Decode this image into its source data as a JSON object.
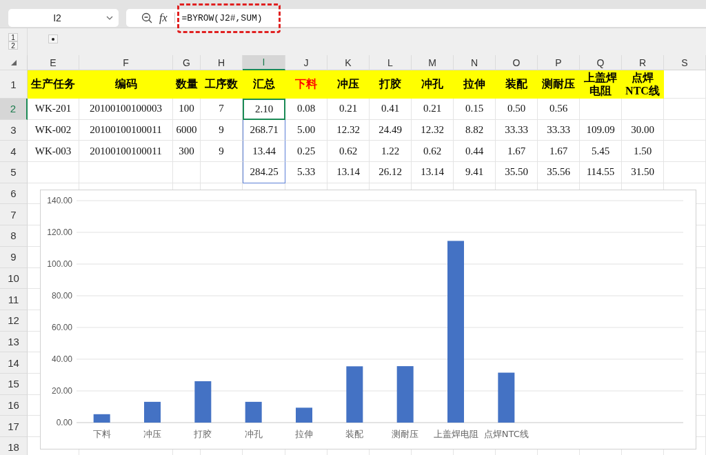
{
  "formula_bar": {
    "name_box": "I2",
    "function_label": "fx",
    "formula": "=BYROW(J2#,SUM)",
    "highlighted": true
  },
  "outline": {
    "levels": [
      "1",
      "2"
    ]
  },
  "columns": [
    {
      "label": "E",
      "selected": false
    },
    {
      "label": "F",
      "selected": false
    },
    {
      "label": "G",
      "selected": false
    },
    {
      "label": "H",
      "selected": false
    },
    {
      "label": "I",
      "selected": true
    },
    {
      "label": "J",
      "selected": false
    },
    {
      "label": "K",
      "selected": false
    },
    {
      "label": "L",
      "selected": false
    },
    {
      "label": "M",
      "selected": false
    },
    {
      "label": "N",
      "selected": false
    },
    {
      "label": "O",
      "selected": false
    },
    {
      "label": "P",
      "selected": false
    },
    {
      "label": "Q",
      "selected": false
    },
    {
      "label": "R",
      "selected": false
    },
    {
      "label": "S",
      "selected": false
    }
  ],
  "rows": [
    {
      "header": "1",
      "kind": "header",
      "selected": false,
      "cells": [
        {
          "text": "生产任务",
          "color": "#000000"
        },
        {
          "text": "编码",
          "color": "#000000"
        },
        {
          "text": "数量",
          "color": "#000000"
        },
        {
          "text": "工序数",
          "color": "#000000"
        },
        {
          "text": "汇总",
          "color": "#000000"
        },
        {
          "text": "下料",
          "color": "#ff0000"
        },
        {
          "text": "冲压",
          "color": "#000000"
        },
        {
          "text": "打胶",
          "color": "#000000"
        },
        {
          "text": "冲孔",
          "color": "#000000"
        },
        {
          "text": "拉伸",
          "color": "#000000"
        },
        {
          "text": "装配",
          "color": "#000000"
        },
        {
          "text": "测耐压",
          "color": "#000000"
        },
        {
          "text": "上盖焊电阻",
          "color": "#000000"
        },
        {
          "text": "点焊NTC线",
          "color": "#000000"
        }
      ]
    },
    {
      "header": "2",
      "kind": "data",
      "selected": true,
      "range": false,
      "cells": [
        "WK-201",
        "20100100100003",
        "100",
        "7",
        "2.10",
        "0.08",
        "0.21",
        "0.41",
        "0.21",
        "0.15",
        "0.50",
        "0.56",
        null,
        null
      ]
    },
    {
      "header": "3",
      "kind": "data",
      "selected": false,
      "range": true,
      "cells": [
        "WK-002",
        "20100100100011",
        "6000",
        "9",
        "268.71",
        "5.00",
        "12.32",
        "24.49",
        "12.32",
        "8.82",
        "33.33",
        "33.33",
        "109.09",
        "30.00"
      ]
    },
    {
      "header": "4",
      "kind": "data",
      "selected": false,
      "range": true,
      "cells": [
        "WK-003",
        "20100100100011",
        "300",
        "9",
        "13.44",
        "0.25",
        "0.62",
        "1.22",
        "0.62",
        "0.44",
        "1.67",
        "1.67",
        "5.45",
        "1.50"
      ]
    },
    {
      "header": "5",
      "kind": "data",
      "selected": false,
      "range": true,
      "cells": [
        null,
        null,
        null,
        null,
        "284.25",
        "5.33",
        "13.14",
        "26.12",
        "13.14",
        "9.41",
        "35.50",
        "35.56",
        "114.55",
        "31.50"
      ]
    },
    {
      "header": "6",
      "kind": "empty",
      "selected": false,
      "range": false
    },
    {
      "header": "7",
      "kind": "empty",
      "selected": false,
      "range": false
    },
    {
      "header": "8",
      "kind": "empty",
      "selected": false,
      "range": false
    },
    {
      "header": "9",
      "kind": "empty",
      "selected": false,
      "range": false
    },
    {
      "header": "10",
      "kind": "empty",
      "selected": false,
      "range": false
    },
    {
      "header": "11",
      "kind": "empty",
      "selected": false,
      "range": false
    },
    {
      "header": "12",
      "kind": "empty",
      "selected": false,
      "range": false
    },
    {
      "header": "13",
      "kind": "empty",
      "selected": false,
      "range": false
    },
    {
      "header": "14",
      "kind": "empty",
      "selected": false,
      "range": false
    },
    {
      "header": "15",
      "kind": "empty",
      "selected": false,
      "range": false
    },
    {
      "header": "16",
      "kind": "empty",
      "selected": false,
      "range": false
    },
    {
      "header": "17",
      "kind": "empty",
      "selected": false,
      "range": false
    },
    {
      "header": "18",
      "kind": "empty",
      "selected": false,
      "range": false
    }
  ],
  "chart": {
    "chart_data": {
      "type": "bar",
      "categories": [
        "下料",
        "冲压",
        "打胶",
        "冲孔",
        "拉伸",
        "装配",
        "测耐压",
        "上盖焊电阻",
        "点焊NTC线"
      ],
      "series": [
        {
          "color": "#4472c4",
          "values": [
            5.3,
            13.1,
            26.1,
            13.1,
            9.4,
            35.5,
            35.6,
            114.6,
            31.5
          ]
        }
      ],
      "grid": true,
      "ylim": [
        0,
        140
      ],
      "yticks": [
        {
          "value": 0,
          "label": "0.00"
        },
        {
          "value": 20,
          "label": "20.00"
        },
        {
          "value": 40,
          "label": "40.00"
        },
        {
          "value": 60,
          "label": "60.00"
        },
        {
          "value": 80,
          "label": "80.00"
        },
        {
          "value": 100,
          "label": "100.00"
        },
        {
          "value": 120,
          "label": "120.00"
        },
        {
          "value": 140,
          "label": "140.00"
        }
      ]
    }
  }
}
